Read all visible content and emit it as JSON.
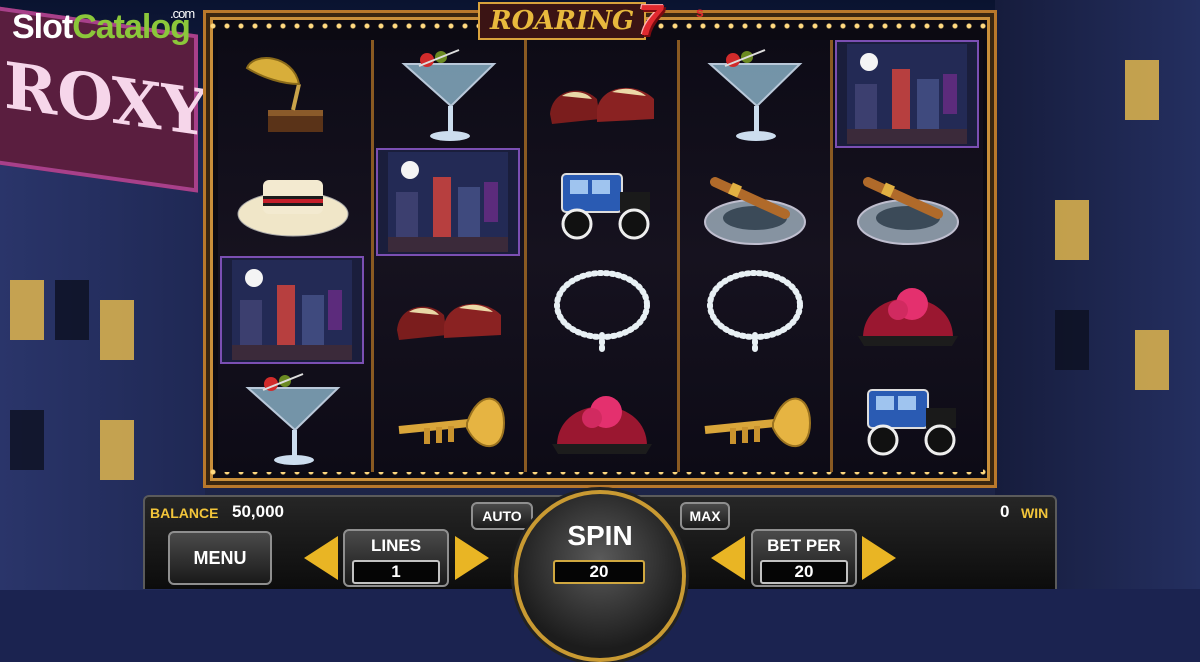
{
  "brand": {
    "slot": "Slot",
    "catalog": "Catalog",
    "com": ".com"
  },
  "background_sign": "ROXY'S",
  "game_title": {
    "word": "ROARING",
    "sevens": "7",
    "suffix": "s"
  },
  "reels": [
    [
      "gramophone",
      "boater-hat",
      "city-scene",
      "martini"
    ],
    [
      "martini",
      "city-scene",
      "oxford-shoes",
      "trumpet"
    ],
    [
      "oxford-shoes",
      "vintage-car",
      "pearl-necklace",
      "cloche-hat"
    ],
    [
      "martini",
      "cigar-ashtray",
      "pearl-necklace",
      "trumpet"
    ],
    [
      "city-scene",
      "cigar-ashtray",
      "cloche-hat",
      "vintage-car"
    ]
  ],
  "controls": {
    "balance_label": "BALANCE",
    "balance_value": "50,000",
    "win_value": "0",
    "win_label": "WIN",
    "menu_label": "MENU",
    "lines_label": "LINES",
    "lines_value": "1",
    "auto_label": "AUTO",
    "max_label": "MAX",
    "spin_label": "SPIN",
    "spin_value": "20",
    "betper_label": "BET PER",
    "betper_value": "20"
  },
  "colors": {
    "accent": "#e9b524",
    "frame": "#b9782b"
  }
}
